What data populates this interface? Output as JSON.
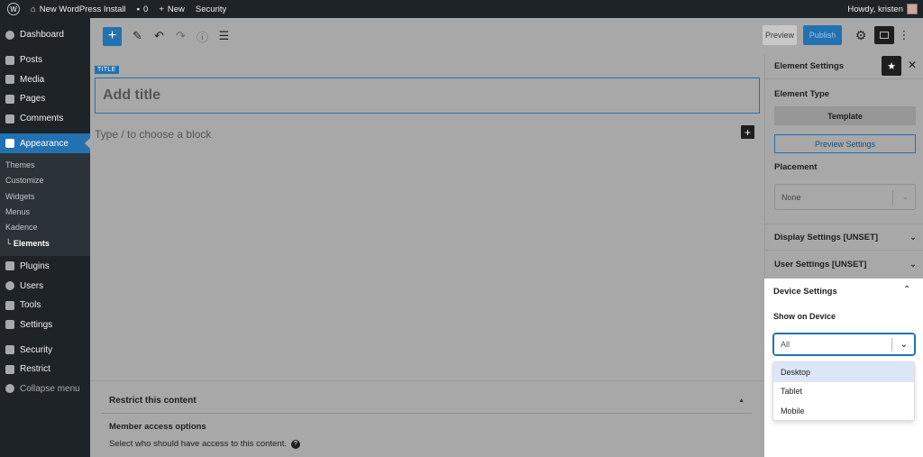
{
  "admin_bar": {
    "site_name": "New WordPress Install",
    "comments_count": "0",
    "new_label": "New",
    "security_label": "Security",
    "howdy": "Howdy, kristen"
  },
  "sidebar": {
    "items_top": [
      {
        "label": "Dashboard",
        "icon": "dashboard-icon"
      },
      {
        "label": "Posts",
        "icon": "pin-icon"
      },
      {
        "label": "Media",
        "icon": "media-icon"
      },
      {
        "label": "Pages",
        "icon": "pages-icon"
      },
      {
        "label": "Comments",
        "icon": "comments-icon"
      }
    ],
    "active": {
      "label": "Appearance",
      "icon": "brush-icon"
    },
    "submenu": [
      "Themes",
      "Customize",
      "Widgets",
      "Menus",
      "Kadence",
      "└ Elements"
    ],
    "items_bottom": [
      {
        "label": "Plugins",
        "icon": "plugins-icon"
      },
      {
        "label": "Users",
        "icon": "users-icon"
      },
      {
        "label": "Tools",
        "icon": "tools-icon"
      },
      {
        "label": "Settings",
        "icon": "settings-icon"
      },
      {
        "label": "Security",
        "icon": "shield-icon"
      },
      {
        "label": "Restrict",
        "icon": "lock-icon"
      },
      {
        "label": "Collapse menu",
        "icon": "collapse-icon"
      }
    ]
  },
  "toolbar": {
    "add_symbol": "+",
    "preview_label": "Preview",
    "publish_label": "Publish"
  },
  "editor": {
    "title_tag": "TITLE",
    "title_placeholder": "Add title",
    "block_hint": "Type / to choose a block"
  },
  "metabox": {
    "title": "Restrict this content",
    "label": "Member access options",
    "description": "Select who should have access to this content."
  },
  "settings_panel": {
    "title": "Element Settings",
    "element_type_label": "Element Type",
    "element_type_value": "Template",
    "preview_settings_label": "Preview Settings",
    "placement_label": "Placement",
    "placement_value": "None",
    "display_settings": "Display Settings [UNSET]",
    "user_settings": "User Settings [UNSET]",
    "device_settings": "Device Settings",
    "show_on_device_label": "Show on Device",
    "show_on_device_value": "All",
    "device_options": [
      "Desktop",
      "Tablet",
      "Mobile"
    ]
  },
  "colors": {
    "accent": "#2271b1",
    "admin_dark": "#1d2327",
    "overlay_gray": "#a8a8a8",
    "option_highlight": "#dde6f7"
  }
}
